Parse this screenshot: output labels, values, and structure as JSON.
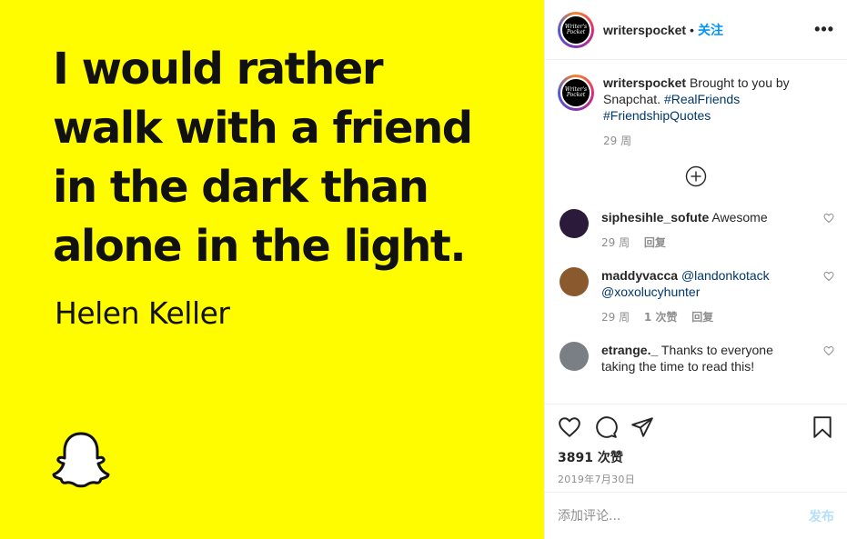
{
  "post_image": {
    "quote_lines": [
      "I would rather",
      "walk with a friend",
      "in the dark than",
      "alone in the light."
    ],
    "author": "Helen Keller",
    "background_color": "#fffc00",
    "logo_icon": "snapchat-ghost-icon"
  },
  "header": {
    "avatar_text": "Writer's Pocket",
    "username": "writerspocket",
    "separator": "•",
    "follow_label": "关注",
    "more_label": "•••"
  },
  "caption": {
    "username": "writerspocket",
    "text": "Brought to you by Snapchat.",
    "tags": [
      "#RealFriends",
      "#FriendshipQuotes"
    ],
    "time": "29 周"
  },
  "load_more_icon": "plus-circle-icon",
  "comments": [
    {
      "username": "siphesihle_sofute",
      "text": "Awesome",
      "time": "29 周",
      "likes": "",
      "reply": "回复",
      "avatar_color": "#2b1a3a"
    },
    {
      "username": "maddyvacca",
      "text": "@landonkotack @xoxolucyhunter",
      "time": "29 周",
      "likes": "1 次赞",
      "reply": "回复",
      "avatar_color": "#8a5a2e"
    },
    {
      "username": "etrange._",
      "text": "Thanks to everyone taking the time to read this!",
      "time": "",
      "likes": "",
      "reply": "",
      "avatar_color": "#7a7f86"
    }
  ],
  "actions": {
    "icons": [
      "heart-icon",
      "comment-icon",
      "share-icon",
      "bookmark-icon"
    ],
    "likes": "3891 次赞",
    "date": "2019年7月30日"
  },
  "add_comment": {
    "placeholder": "添加评论...",
    "post_label": "发布"
  },
  "colors": {
    "link": "#0095f6",
    "hashtag": "#00376b",
    "muted": "#8e8e8e"
  }
}
